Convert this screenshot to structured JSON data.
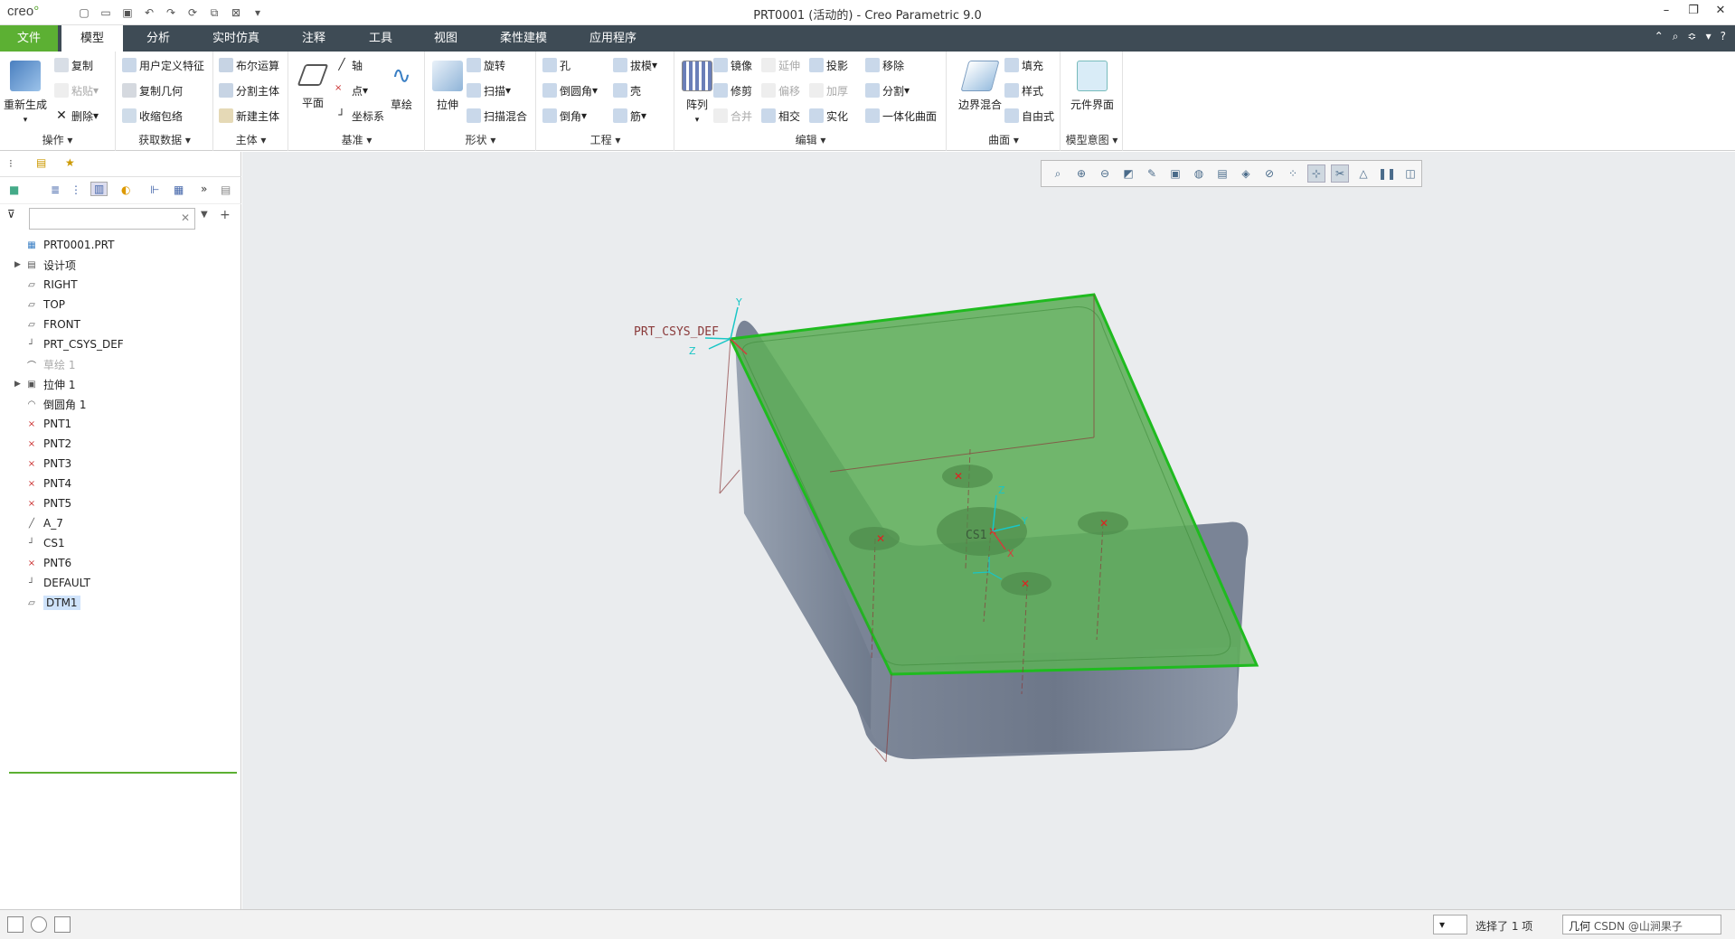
{
  "title": {
    "logo": "creo",
    "window_title": "PRT0001 (活动的) - Creo Parametric 9.0"
  },
  "tabs": [
    "文件",
    "模型",
    "分析",
    "实时仿真",
    "注释",
    "工具",
    "视图",
    "柔性建模",
    "应用程序"
  ],
  "ribbon": {
    "groups": {
      "ops": "操作",
      "getdata": "获取数据",
      "body": "主体",
      "datum": "基准",
      "shape": "形状",
      "eng": "工程",
      "edit": "编辑",
      "surface": "曲面",
      "intent": "模型意图"
    },
    "regen": "重新生成",
    "copy": "复制",
    "paste": "粘贴",
    "delete": "删除",
    "udf": "用户定义特征",
    "copy_geom": "复制几何",
    "shrinkwrap": "收缩包络",
    "boolean": "布尔运算",
    "split_body": "分割主体",
    "new_body": "新建主体",
    "plane": "平面",
    "axis": "轴",
    "point": "点",
    "csys": "坐标系",
    "sketch": "草绘",
    "extrude": "拉伸",
    "revolve": "旋转",
    "sweep": "扫描",
    "swept_blend": "扫描混合",
    "hole": "孔",
    "round": "倒圆角",
    "chamfer": "倒角",
    "draft": "拔模",
    "shell": "壳",
    "rib": "筋",
    "pattern": "阵列",
    "mirror": "镜像",
    "trim": "修剪",
    "merge": "合并",
    "extend": "延伸",
    "offset": "偏移",
    "intersect": "相交",
    "project": "投影",
    "thicken": "加厚",
    "solidify": "实化",
    "remove": "移除",
    "split": "分割",
    "unify": "一体化曲面",
    "boundary_blend": "边界混合",
    "fill": "填充",
    "style": "样式",
    "freestyle": "自由式",
    "component_interface": "元件界面"
  },
  "tree": {
    "items": [
      {
        "label": "PRT0001.PRT",
        "icon": "part-icon",
        "exp": ""
      },
      {
        "label": "设计项",
        "icon": "design-items-icon",
        "exp": "▶"
      },
      {
        "label": "RIGHT",
        "icon": "datum-plane-icon",
        "exp": ""
      },
      {
        "label": "TOP",
        "icon": "datum-plane-icon",
        "exp": ""
      },
      {
        "label": "FRONT",
        "icon": "datum-plane-icon",
        "exp": ""
      },
      {
        "label": "PRT_CSYS_DEF",
        "icon": "csys-icon",
        "exp": ""
      },
      {
        "label": "草绘 1",
        "icon": "sketch-icon",
        "exp": ""
      },
      {
        "label": "拉伸 1",
        "icon": "extrude-icon",
        "exp": "▶"
      },
      {
        "label": "倒圆角 1",
        "icon": "round-icon",
        "exp": ""
      },
      {
        "label": "PNT1",
        "icon": "datum-point-icon",
        "exp": ""
      },
      {
        "label": "PNT2",
        "icon": "datum-point-icon",
        "exp": ""
      },
      {
        "label": "PNT3",
        "icon": "datum-point-icon",
        "exp": ""
      },
      {
        "label": "PNT4",
        "icon": "datum-point-icon",
        "exp": ""
      },
      {
        "label": "PNT5",
        "icon": "datum-point-icon",
        "exp": ""
      },
      {
        "label": "A_7",
        "icon": "datum-axis-icon",
        "exp": ""
      },
      {
        "label": "CS1",
        "icon": "csys-icon",
        "exp": ""
      },
      {
        "label": "PNT6",
        "icon": "datum-point-icon",
        "exp": ""
      },
      {
        "label": "DEFAULT",
        "icon": "csys-icon",
        "exp": ""
      },
      {
        "label": "DTM1",
        "icon": "datum-plane-icon",
        "exp": ""
      }
    ]
  },
  "model": {
    "csys_label": "PRT_CSYS_DEF",
    "cs1_label": "CS1",
    "axis_y": "Y",
    "axis_z": "Z",
    "axis_x": "X"
  },
  "status": {
    "selected": "选择了 1 项",
    "filter": "几何",
    "watermark": "CSDN @山涧果子"
  },
  "colors": {
    "file_tab": "#5cb033",
    "tabbar": "#3e4b55",
    "datum_plane_fill": "#5fae5a",
    "viewport_bg": "#eaecee"
  }
}
